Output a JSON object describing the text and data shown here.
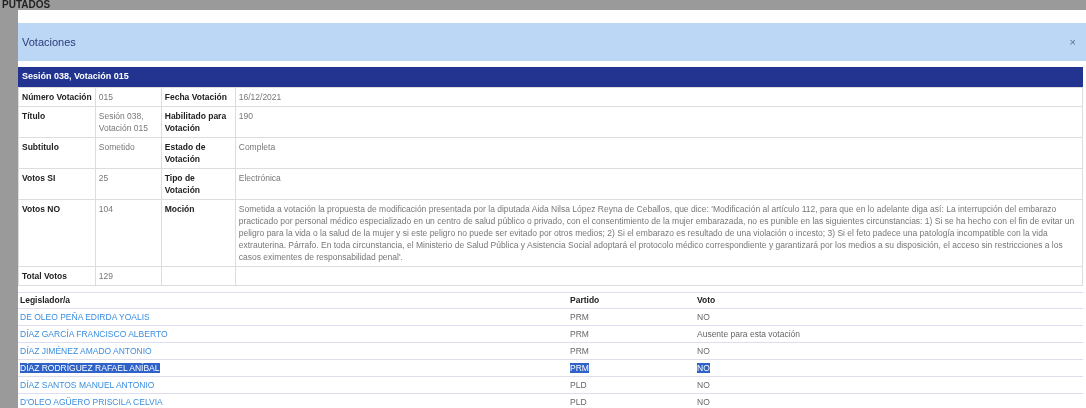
{
  "background": {
    "title": "PUTADOS"
  },
  "modal": {
    "title": "Votaciones",
    "close": "×"
  },
  "session": {
    "title": "Sesión 038, Votación 015",
    "rows": [
      {
        "label_1": "Número Votación",
        "value_1": "015",
        "label_2": "Fecha Votación",
        "value_2": "16/12/2021"
      },
      {
        "label_1": "Título",
        "value_1": "Sesión 038, Votación 015",
        "label_2": "Habilitado para Votación",
        "value_2": "190"
      },
      {
        "label_1": "Subtitulo",
        "value_1": "Sometido",
        "label_2": "Estado de Votación",
        "value_2": "Completa"
      },
      {
        "label_1": "Votos SI",
        "value_1": "25",
        "label_2": "Tipo de Votación",
        "value_2": "Electrónica"
      },
      {
        "label_1": "Votos NO",
        "value_1": "104",
        "label_2": "Moción",
        "value_2": "Sometida a votación la propuesta de modificación presentada por la diputada Aida Nilsa López Reyna de Ceballos, que dice: 'Modificación al artículo 112, para que en lo adelante diga así: La interrupción del embarazo practicado por personal médico especializado en un centro de salud público o privado, con el consentimiento de la mujer embarazada, no es punible en las siguientes circunstancias: 1) Si se ha hecho con el fin de evitar un peligro para la vida o la salud de la mujer y si este peligro no puede ser evitado por otros medios; 2) Si el embarazo es resultado de una violación o incesto; 3) Si el feto padece una patología incompatible con la vida extrauterina. Párrafo. En toda circunstancia, el Ministerio de Salud Pública y Asistencia Social adoptará el protocolo médico correspondiente y garantizará por los medios a su disposición, el acceso sin restricciones a los casos eximentes de responsabilidad penal'."
      },
      {
        "label_1": "Total Votos",
        "value_1": "129"
      }
    ]
  },
  "votes": {
    "columns": [
      "Legislador/a",
      "Partido",
      "Voto"
    ],
    "rows": [
      {
        "name": "DE OLEO PEÑA EDIRDA YOALIS",
        "party": "PRM",
        "vote": "NO",
        "selected": false
      },
      {
        "name": "DÍAZ GARCÍA FRANCISCO ALBERTO",
        "party": "PRM",
        "vote": "Ausente para esta votación",
        "selected": false
      },
      {
        "name": "DÍAZ JIMÉNEZ AMADO ANTONIO",
        "party": "PRM",
        "vote": "NO",
        "selected": false
      },
      {
        "name": "DÍAZ RODRÍGUEZ RAFAEL ANÍBAL",
        "party": "PRM",
        "vote": "NO",
        "selected": true
      },
      {
        "name": "DÍAZ SANTOS MANUEL ANTONIO",
        "party": "PLD",
        "vote": "NO",
        "selected": false
      },
      {
        "name": "D'OLEO AGÜERO PRISCILA CELVIA",
        "party": "PLD",
        "vote": "NO",
        "selected": false
      }
    ]
  }
}
